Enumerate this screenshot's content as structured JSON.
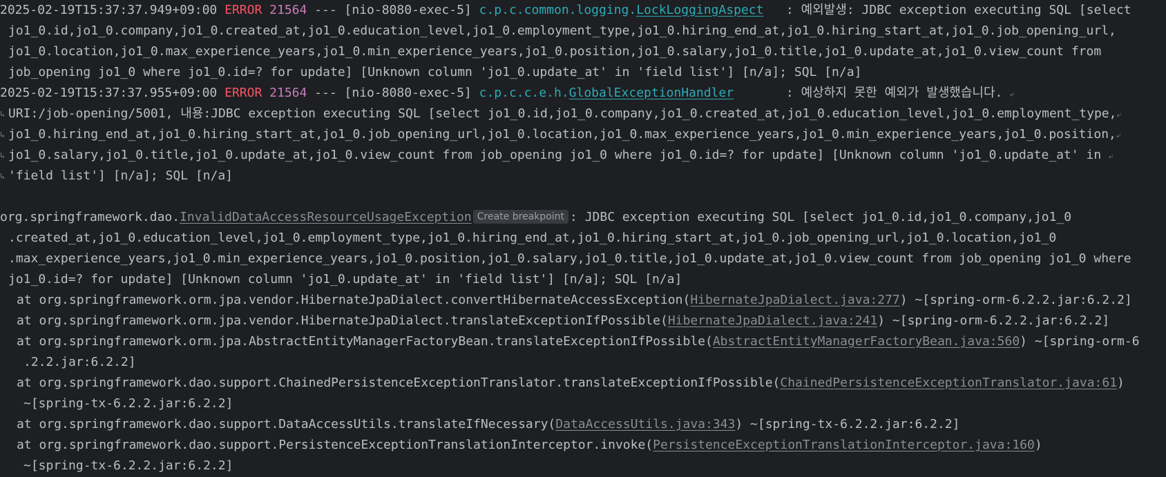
{
  "log1": {
    "timestamp": "2025-02-19T15:37:37.949+09:00",
    "level": "ERROR",
    "pid": "21564",
    "separator": " --- ",
    "thread": "[nio-8080-exec-5]",
    "logger_prefix": "c.p.c.common.logging.",
    "logger_class": "LockLoggingAspect",
    "message_start": "   : 예외발생: JDBC exception executing SQL [select",
    "cont": [
      "jo1_0.id,jo1_0.company,jo1_0.created_at,jo1_0.education_level,jo1_0.employment_type,jo1_0.hiring_end_at,jo1_0.hiring_start_at,jo1_0.job_opening_url,",
      "jo1_0.location,jo1_0.max_experience_years,jo1_0.min_experience_years,jo1_0.position,jo1_0.salary,jo1_0.title,jo1_0.update_at,jo1_0.view_count from",
      "job_opening jo1_0 where jo1_0.id=? for update] [Unknown column 'jo1_0.update_at' in 'field list'] [n/a]; SQL [n/a]"
    ]
  },
  "log2": {
    "timestamp": "2025-02-19T15:37:37.955+09:00",
    "level": "ERROR",
    "pid": "21564",
    "separator": " --- ",
    "thread": "[nio-8080-exec-5]",
    "logger_prefix": "c.p.c.c.e.h.",
    "logger_class": "GlobalExceptionHandler",
    "message_start": "       : 예상하지 못한 예외가 발생했습니다. ",
    "cont": [
      "URI:/job-opening/5001, 내용:JDBC exception executing SQL [select jo1_0.id,jo1_0.company,jo1_0.created_at,jo1_0.education_level,jo1_0.employment_type,",
      "jo1_0.hiring_end_at,jo1_0.hiring_start_at,jo1_0.job_opening_url,jo1_0.location,jo1_0.max_experience_years,jo1_0.min_experience_years,jo1_0.position,",
      "jo1_0.salary,jo1_0.title,jo1_0.update_at,jo1_0.view_count from job_opening jo1_0 where jo1_0.id=? for update] [Unknown column 'jo1_0.update_at' in ",
      "'field list'] [n/a]; SQL [n/a]"
    ]
  },
  "exception": {
    "package": "org.springframework.dao.",
    "class_name": "InvalidDataAccessResourceUsageException",
    "breakpoint_hint": "Create breakpoint",
    "message_start": ": JDBC exception executing SQL [select jo1_0.id,jo1_0.company,jo1_0",
    "cont": [
      ".created_at,jo1_0.education_level,jo1_0.employment_type,jo1_0.hiring_end_at,jo1_0.hiring_start_at,jo1_0.job_opening_url,jo1_0.location,jo1_0",
      ".max_experience_years,jo1_0.min_experience_years,jo1_0.position,jo1_0.salary,jo1_0.title,jo1_0.update_at,jo1_0.view_count from job_opening jo1_0 where",
      "jo1_0.id=? for update] [Unknown column 'jo1_0.update_at' in 'field list'] [n/a]; SQL [n/a]"
    ]
  },
  "stack": [
    {
      "at": "at org.springframework.orm.jpa.vendor.HibernateJpaDialect.convertHibernateAccessException(",
      "link": "HibernateJpaDialect.java:277",
      "suffix": ") ~[spring-orm-6.2.2.jar:6.2.2]",
      "wrap": ""
    },
    {
      "at": "at org.springframework.orm.jpa.vendor.HibernateJpaDialect.translateExceptionIfPossible(",
      "link": "HibernateJpaDialect.java:241",
      "suffix": ") ~[spring-orm-6.2.2.jar:6.2.2]",
      "wrap": ""
    },
    {
      "at": "at org.springframework.orm.jpa.AbstractEntityManagerFactoryBean.translateExceptionIfPossible(",
      "link": "AbstractEntityManagerFactoryBean.java:560",
      "suffix": ") ~[spring-orm-6",
      "wrap": ".2.2.jar:6.2.2]"
    },
    {
      "at": "at org.springframework.dao.support.ChainedPersistenceExceptionTranslator.translateExceptionIfPossible(",
      "link": "ChainedPersistenceExceptionTranslator.java:61",
      "suffix": ")",
      "wrap": "~[spring-tx-6.2.2.jar:6.2.2]"
    },
    {
      "at": "at org.springframework.dao.support.DataAccessUtils.translateIfNecessary(",
      "link": "DataAccessUtils.java:343",
      "suffix": ") ~[spring-tx-6.2.2.jar:6.2.2]",
      "wrap": ""
    },
    {
      "at": "at org.springframework.dao.support.PersistenceExceptionTranslationInterceptor.invoke(",
      "link": "PersistenceExceptionTranslationInterceptor.java:160",
      "suffix": ")",
      "wrap": "~[spring-tx-6.2.2.jar:6.2.2]"
    }
  ],
  "icons": {
    "wrap_end": "soft-wrap-end-icon",
    "wrap_start": "soft-wrap-start-icon"
  },
  "colors": {
    "background": "#1e1f22",
    "text": "#bcbec4",
    "error": "#f75464",
    "pid": "#c77dbb",
    "logger": "#2aacb8",
    "link": "#8a8d93"
  }
}
